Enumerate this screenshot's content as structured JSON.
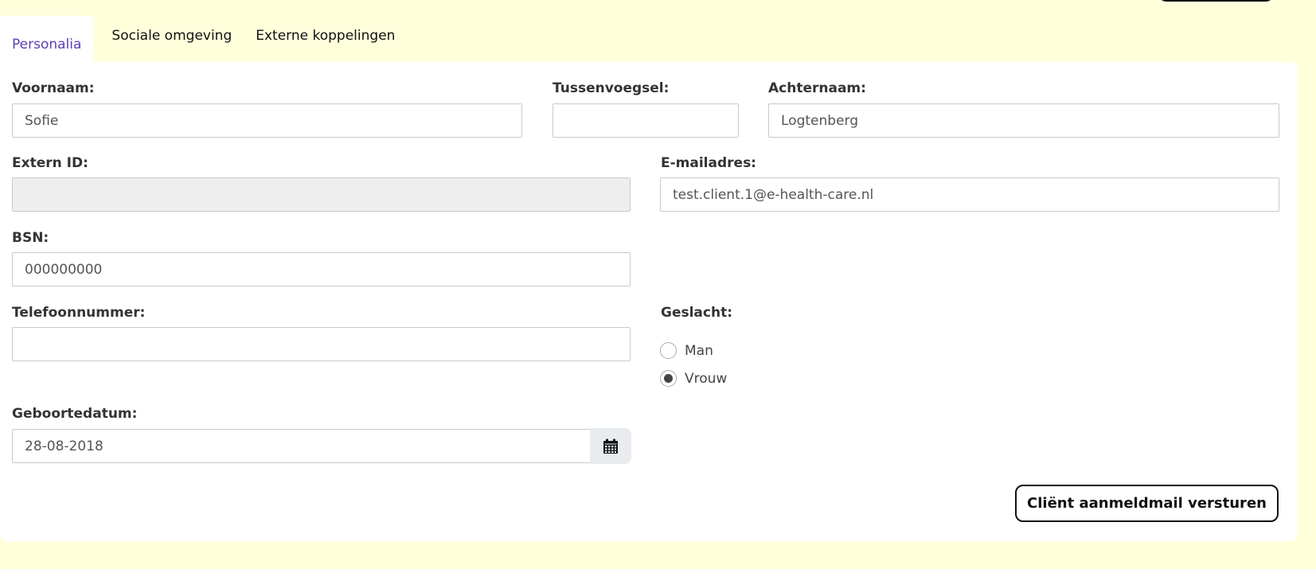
{
  "tabs": [
    {
      "label": "Personalia",
      "active": true
    },
    {
      "label": "Sociale omgeving",
      "active": false
    },
    {
      "label": "Externe koppelingen",
      "active": false
    }
  ],
  "form": {
    "voornaam": {
      "label": "Voornaam:",
      "value": "Sofie"
    },
    "tussenvoegsel": {
      "label": "Tussenvoegsel:",
      "value": ""
    },
    "achternaam": {
      "label": "Achternaam:",
      "value": "Logtenberg"
    },
    "extern_id": {
      "label": "Extern ID:",
      "value": ""
    },
    "email": {
      "label": "E-mailadres:",
      "value": "test.client.1@e-health-care.nl"
    },
    "bsn": {
      "label": "BSN:",
      "value": "000000000"
    },
    "telefoon": {
      "label": "Telefoonnummer:",
      "value": ""
    },
    "geslacht": {
      "label": "Geslacht:",
      "options": [
        {
          "label": "Man",
          "checked": false
        },
        {
          "label": "Vrouw",
          "checked": true
        }
      ]
    },
    "geboortedatum": {
      "label": "Geboortedatum:",
      "value": "28-08-2018",
      "icon": "calendar-icon"
    }
  },
  "actions": {
    "send_label": "Cliënt aanmeldmail versturen"
  },
  "colors": {
    "background": "#ffffdc",
    "active_tab": "#5b3fb5"
  }
}
